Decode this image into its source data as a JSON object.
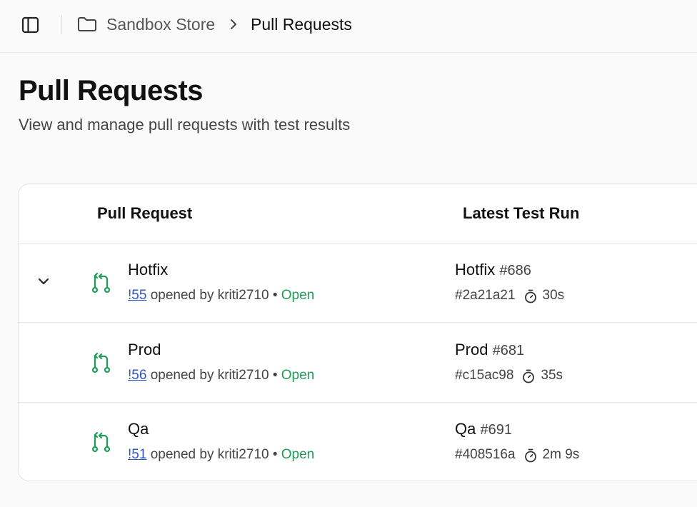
{
  "breadcrumb": {
    "icon": "folder-icon",
    "root": "Sandbox Store",
    "separator_icon": "chevron-right-icon",
    "current": "Pull Requests"
  },
  "header": {
    "sidebar_toggle_icon": "sidebar-panel-icon",
    "title": "Pull Requests",
    "subtitle": "View and manage pull requests with test results"
  },
  "table": {
    "columns": {
      "pull_request": "Pull Request",
      "latest_test_run": "Latest Test Run"
    },
    "rows": [
      {
        "expanded_icon": "chevron-down-icon",
        "pr_icon": "git-pull-request-icon",
        "title": "Hotfix",
        "number": "!55",
        "opened_by": "opened by kriti2710",
        "bullet": "•",
        "status": "Open",
        "run_name": "Hotfix",
        "run_number": "#686",
        "commit": "#2a21a21",
        "timer_icon": "stopwatch-icon",
        "duration": "30s"
      },
      {
        "pr_icon": "git-pull-request-icon",
        "title": "Prod",
        "number": "!56",
        "opened_by": "opened by kriti2710",
        "bullet": "•",
        "status": "Open",
        "run_name": "Prod",
        "run_number": "#681",
        "commit": "#c15ac98",
        "timer_icon": "stopwatch-icon",
        "duration": "35s"
      },
      {
        "pr_icon": "git-pull-request-icon",
        "title": "Qa",
        "number": "!51",
        "opened_by": "opened by kriti2710",
        "bullet": "•",
        "status": "Open",
        "run_name": "Qa",
        "run_number": "#691",
        "commit": "#408516a",
        "timer_icon": "stopwatch-icon",
        "duration": "2m 9s"
      }
    ]
  },
  "colors": {
    "link": "#2f56c6",
    "status_open": "#1f9d55",
    "pr_icon": "#1f9d55",
    "background": "#fafafa",
    "card": "#ffffff"
  }
}
